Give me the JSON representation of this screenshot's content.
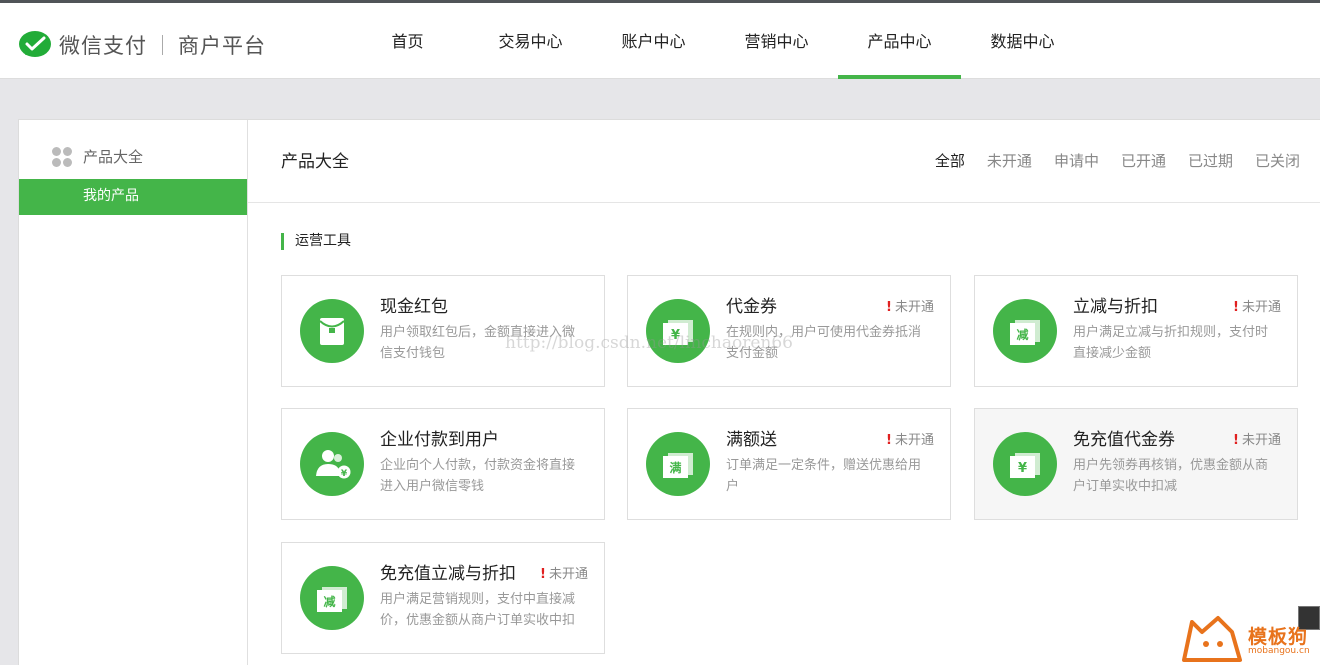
{
  "header": {
    "logo_text": "微信支付",
    "logo_sub": "商户平台",
    "nav": [
      {
        "label": "首页"
      },
      {
        "label": "交易中心"
      },
      {
        "label": "账户中心"
      },
      {
        "label": "营销中心"
      },
      {
        "label": "产品中心",
        "active": true
      },
      {
        "label": "数据中心"
      }
    ]
  },
  "sidebar": {
    "heading": "产品大全",
    "items": [
      {
        "label": "我的产品",
        "active": true
      }
    ]
  },
  "main": {
    "title": "产品大全",
    "filters": [
      {
        "label": "全部",
        "active": true
      },
      {
        "label": "未开通"
      },
      {
        "label": "申请中"
      },
      {
        "label": "已开通"
      },
      {
        "label": "已过期"
      },
      {
        "label": "已关闭"
      }
    ],
    "section_title": "运营工具",
    "cards": [
      {
        "title": "现金红包",
        "status": "",
        "desc": "用户领取红包后，金额直接进入微信支付钱包",
        "icon": "red-envelope-icon"
      },
      {
        "title": "代金券",
        "status": "未开通",
        "desc": "在规则内，用户可使用代金券抵消支付金额",
        "icon": "voucher-yen-icon",
        "glyph": "¥"
      },
      {
        "title": "立减与折扣",
        "status": "未开通",
        "desc": "用户满足立减与折扣规则，支付时直接减少金额",
        "icon": "discount-voucher-icon",
        "glyph": "减"
      },
      {
        "title": "企业付款到用户",
        "status": "",
        "desc": "企业向个人付款，付款资金将直接进入用户微信零钱",
        "icon": "enterprise-payment-icon"
      },
      {
        "title": "满额送",
        "status": "未开通",
        "desc": "订单满足一定条件，赠送优惠给用户",
        "icon": "full-amount-gift-icon",
        "glyph": "满"
      },
      {
        "title": "免充值代金券",
        "status": "未开通",
        "desc": "用户先领券再核销，优惠金额从商户订单实收中扣减",
        "icon": "voucher-yen-icon",
        "glyph": "¥"
      },
      {
        "title": "免充值立减与折扣",
        "status": "未开通",
        "desc": "用户满足营销规则，支付中直接减价，优惠金额从商户订单实收中扣",
        "icon": "discount-voucher-icon",
        "glyph": "减"
      }
    ]
  },
  "watermark": "http://blog.csdn.net/linchaoren66",
  "corner_logo": {
    "brand": "模板狗",
    "sub": "mobangou.cn"
  },
  "colors": {
    "accent": "#44b549",
    "alert": "#e02020",
    "brand_orange": "#e8731c"
  }
}
